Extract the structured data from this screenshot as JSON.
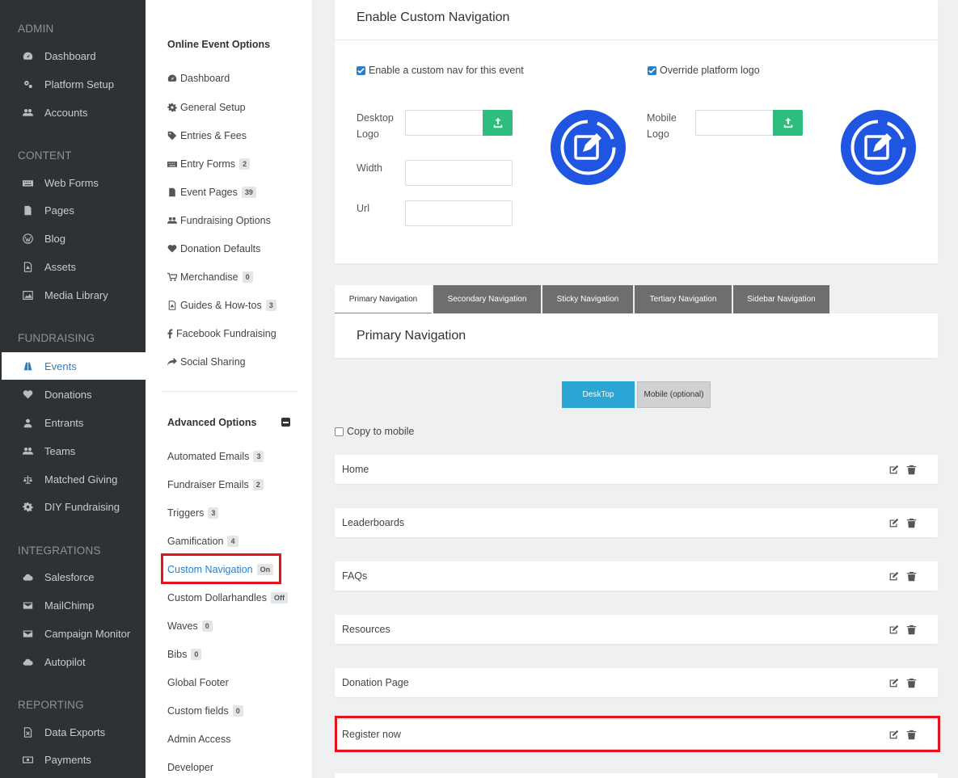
{
  "sidebar": {
    "sections": [
      {
        "title": "ADMIN",
        "items": [
          {
            "label": "Dashboard",
            "icon": "dashboard-icon"
          },
          {
            "label": "Platform Setup",
            "icon": "gears-icon"
          },
          {
            "label": "Accounts",
            "icon": "users-icon"
          }
        ]
      },
      {
        "title": "CONTENT",
        "items": [
          {
            "label": "Web Forms",
            "icon": "keyboard-icon"
          },
          {
            "label": "Pages",
            "icon": "file-icon"
          },
          {
            "label": "Blog",
            "icon": "wordpress-icon"
          },
          {
            "label": "Assets",
            "icon": "file-pdf-icon"
          },
          {
            "label": "Media Library",
            "icon": "image-icon"
          }
        ]
      },
      {
        "title": "FUNDRAISING",
        "items": [
          {
            "label": "Events",
            "icon": "road-icon"
          },
          {
            "label": "Donations",
            "icon": "heart-icon"
          },
          {
            "label": "Entrants",
            "icon": "user-icon"
          },
          {
            "label": "Teams",
            "icon": "users-icon"
          },
          {
            "label": "Matched Giving",
            "icon": "balance-scale-icon"
          },
          {
            "label": "DIY Fundraising",
            "icon": "gear-icon"
          }
        ]
      },
      {
        "title": "INTEGRATIONS",
        "items": [
          {
            "label": "Salesforce",
            "icon": "cloud-icon"
          },
          {
            "label": "MailChimp",
            "icon": "envelope-icon"
          },
          {
            "label": "Campaign Monitor",
            "icon": "envelope-icon"
          },
          {
            "label": "Autopilot",
            "icon": "cloud-icon"
          }
        ]
      },
      {
        "title": "REPORTING",
        "items": [
          {
            "label": "Data Exports",
            "icon": "file-excel-icon"
          },
          {
            "label": "Payments",
            "icon": "money-icon"
          }
        ]
      }
    ]
  },
  "options": {
    "online_title": "Online Event Options",
    "online_items": [
      {
        "label": "Dashboard",
        "icon": "dashboard-icon",
        "badge": ""
      },
      {
        "label": "General Setup",
        "icon": "gear-icon",
        "badge": ""
      },
      {
        "label": "Entries & Fees",
        "icon": "tag-icon",
        "badge": ""
      },
      {
        "label": "Entry Forms",
        "icon": "keyboard-icon",
        "badge": "2"
      },
      {
        "label": "Event Pages",
        "icon": "file-icon",
        "badge": "39"
      },
      {
        "label": "Fundraising Options",
        "icon": "users-icon",
        "badge": ""
      },
      {
        "label": "Donation Defaults",
        "icon": "heart-icon",
        "badge": ""
      },
      {
        "label": "Merchandise",
        "icon": "cart-icon",
        "badge": "0"
      },
      {
        "label": "Guides & How-tos",
        "icon": "file-pdf-icon",
        "badge": "3"
      },
      {
        "label": "Facebook Fundraising",
        "icon": "facebook-icon",
        "badge": ""
      },
      {
        "label": "Social Sharing",
        "icon": "share-icon",
        "badge": ""
      }
    ],
    "advanced_title": "Advanced Options",
    "advanced_items": [
      {
        "label": "Automated Emails",
        "badge": "3"
      },
      {
        "label": "Fundraiser Emails",
        "badge": "2"
      },
      {
        "label": "Triggers",
        "badge": "3"
      },
      {
        "label": "Gamification",
        "badge": "4"
      },
      {
        "label": "Custom Navigation",
        "badge": "On"
      },
      {
        "label": "Custom Dollarhandles",
        "badge": "Off"
      },
      {
        "label": "Waves",
        "badge": "0"
      },
      {
        "label": "Bibs",
        "badge": "0"
      },
      {
        "label": "Global Footer",
        "badge": ""
      },
      {
        "label": "Custom fields",
        "badge": "0"
      },
      {
        "label": "Admin Access",
        "badge": ""
      },
      {
        "label": "Developer",
        "badge": ""
      }
    ]
  },
  "main": {
    "card_title": "Enable Custom Navigation",
    "enable_custom_nav_label": "Enable a custom nav for this event",
    "override_logo_label": "Override platform logo",
    "desktop_logo_label": "Desktop\nLogo",
    "width_label": "Width",
    "url_label": "Url",
    "mobile_logo_label": "Mobile\nLogo",
    "tabs": [
      "Primary Navigation",
      "Secondary Navigation",
      "Sticky Navigation",
      "Tertiary Navigation",
      "Sidebar Navigation"
    ],
    "section_title": "Primary Navigation",
    "device_toggle": [
      "DeskTop",
      "Mobile (optional)"
    ],
    "copy_to_mobile_label": "Copy to mobile",
    "nav_items": [
      "Home",
      "Leaderboards",
      "FAQs",
      "Resources",
      "Donation Page",
      "Register now"
    ]
  },
  "colors": {
    "sidebar_bg": "#2e3235",
    "accent_blue": "#2a7fc9",
    "upload_green": "#2ebd7f",
    "logo_blue": "#1f55e0",
    "tab_gray": "#6c6e70",
    "desktop_btn": "#2ba5d4",
    "highlight_red": "#e3141b"
  }
}
